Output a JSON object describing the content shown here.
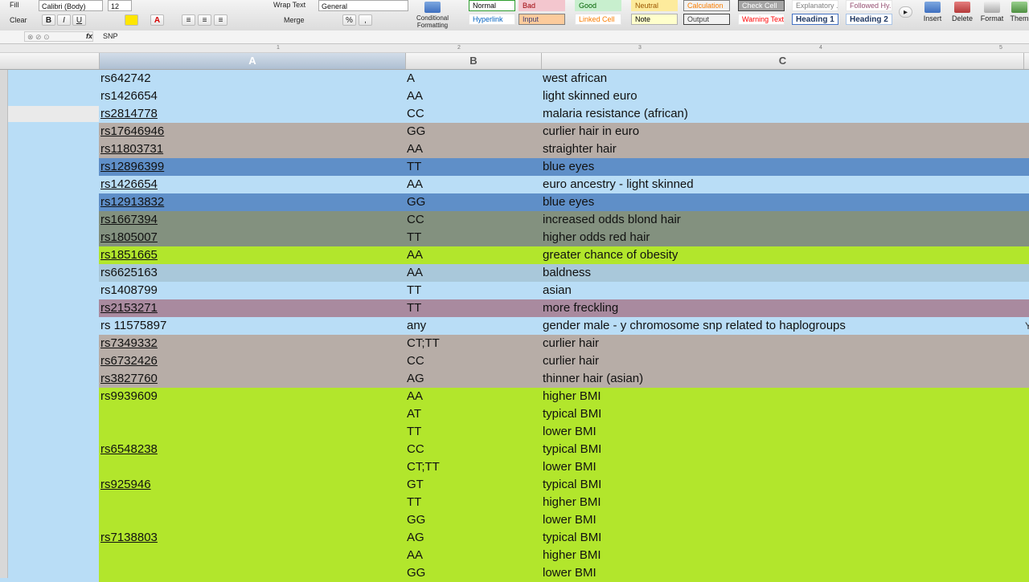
{
  "ribbon": {
    "fill_label": "Fill",
    "clear_label": "Clear",
    "font_name": "Calibri (Body)",
    "font_size": "12",
    "bold": "B",
    "italic": "I",
    "underline": "U",
    "wrap_text": "Wrap Text",
    "merge": "Merge",
    "number_format": "General",
    "percent": "%",
    "comma": ",",
    "conditional_formatting": "Conditional Formatting",
    "styles": [
      {
        "label": "Normal",
        "bg": "#ffffff",
        "fg": "#000000",
        "border": "#2e9e2e"
      },
      {
        "label": "Bad",
        "bg": "#f3c6ce",
        "fg": "#9c0006",
        "border": "#f3c6ce"
      },
      {
        "label": "Good",
        "bg": "#c8efce",
        "fg": "#006100",
        "border": "#c8efce"
      },
      {
        "label": "Neutral",
        "bg": "#fdeb9c",
        "fg": "#9c5700",
        "border": "#fdeb9c"
      },
      {
        "label": "Calculation",
        "bg": "#f2f2f2",
        "fg": "#fa7d00",
        "border": "#7f7f7f"
      },
      {
        "label": "Check Cell",
        "bg": "#a5a5a5",
        "fg": "#ffffff",
        "border": "#3f3f3f"
      },
      {
        "label": "Explanatory ...",
        "bg": "#ffffff",
        "fg": "#7f7f7f",
        "border": "#e6e6e6"
      },
      {
        "label": "Followed Hy...",
        "bg": "#ffffff",
        "fg": "#954f72",
        "border": "#e6e6e6"
      },
      {
        "label": "Hyperlink",
        "bg": "#ffffff",
        "fg": "#0563c1",
        "border": "#e6e6e6"
      },
      {
        "label": "Input",
        "bg": "#fccb9c",
        "fg": "#3f3f76",
        "border": "#7f7f7f"
      },
      {
        "label": "Linked Cell",
        "bg": "#ffffff",
        "fg": "#fa7d00",
        "border": "#e6e6e6"
      },
      {
        "label": "Note",
        "bg": "#ffffcc",
        "fg": "#000000",
        "border": "#b2b2b2"
      },
      {
        "label": "Output",
        "bg": "#f2f2f2",
        "fg": "#3f3f3f",
        "border": "#3f3f3f"
      },
      {
        "label": "Warning Text",
        "bg": "#ffffff",
        "fg": "#ff0000",
        "border": "#e6e6e6"
      },
      {
        "label": "Heading 1",
        "bg": "#ffffff",
        "fg": "#1f3864",
        "border": "#4472c4"
      },
      {
        "label": "Heading 2",
        "bg": "#ffffff",
        "fg": "#1f3864",
        "border": "#a9c4e7"
      }
    ],
    "insert": "Insert",
    "delete": "Delete",
    "format": "Format",
    "themes": "Them"
  },
  "formula_bar": {
    "fx": "fx",
    "content": "SNP"
  },
  "columns": [
    "A",
    "B",
    "C"
  ],
  "rows": [
    {
      "a": "rs642742",
      "b": "A",
      "c": "west african",
      "d": "",
      "link": false,
      "bg": "#b9ddf6"
    },
    {
      "a": "rs1426654",
      "b": "AA",
      "c": "light skinned euro",
      "d": "",
      "link": false,
      "bg": "#b9ddf6"
    },
    {
      "a": "rs2814778",
      "b": "CC",
      "c": "malaria resistance (african)",
      "d": "",
      "link": true,
      "bg": "#b9ddf6"
    },
    {
      "a": "rs17646946",
      "b": "GG",
      "c": "curlier hair in euro",
      "d": "",
      "link": true,
      "bg": "#b7ada7"
    },
    {
      "a": "rs11803731",
      "b": "AA",
      "c": "straighter hair",
      "d": "",
      "link": true,
      "bg": "#b7ada7"
    },
    {
      "a": "rs12896399",
      "b": "TT",
      "c": "blue eyes",
      "d": "",
      "link": true,
      "bg": "#5f8fc8"
    },
    {
      "a": "rs1426654",
      "b": "AA",
      "c": "euro ancestry - light skinned",
      "d": "",
      "link": true,
      "bg": "#b9ddf6"
    },
    {
      "a": "rs12913832",
      "b": "GG",
      "c": "blue eyes",
      "d": "",
      "link": true,
      "bg": "#5f8fc8"
    },
    {
      "a": "rs1667394",
      "b": "CC",
      "c": "increased odds blond hair",
      "d": "",
      "link": true,
      "bg": "#83917f"
    },
    {
      "a": "rs1805007",
      "b": "TT",
      "c": "higher odds red hair",
      "d": "",
      "link": true,
      "bg": "#83917f"
    },
    {
      "a": "rs1851665",
      "b": "AA",
      "c": "greater chance of obesity",
      "d": "",
      "link": true,
      "bg": "#b2e62c"
    },
    {
      "a": "rs6625163",
      "b": "AA",
      "c": "baldness",
      "d": "",
      "link": false,
      "bg": "#a9c8da"
    },
    {
      "a": "rs1408799",
      "b": "TT",
      "c": "asian",
      "d": "",
      "link": false,
      "bg": "#b9ddf6"
    },
    {
      "a": "rs2153271",
      "b": "TT",
      "c": "more freckling",
      "d": "",
      "link": true,
      "bg": "#a98a9f"
    },
    {
      "a": "rs 11575897",
      "b": "any",
      "c": "gender male - y chromosome snp related to haplogroups",
      "d": "Y",
      "link": false,
      "bg": "#b9ddf6"
    },
    {
      "a": "rs7349332",
      "b": "CT;TT",
      "c": "curlier hair",
      "d": "",
      "link": true,
      "bg": "#b7ada7"
    },
    {
      "a": "rs6732426",
      "b": "CC",
      "c": "curlier hair",
      "d": "",
      "link": true,
      "bg": "#b7ada7"
    },
    {
      "a": "rs3827760",
      "b": "AG",
      "c": "thinner hair (asian)",
      "d": "",
      "link": true,
      "bg": "#b7ada7"
    },
    {
      "a": "rs9939609",
      "b": "AA",
      "c": "higher BMI",
      "d": "",
      "link": false,
      "bg": "#b2e62c"
    },
    {
      "a": "",
      "b": "AT",
      "c": "typical BMI",
      "d": "",
      "link": false,
      "bg": "#b2e62c"
    },
    {
      "a": "",
      "b": "TT",
      "c": "lower BMI",
      "d": "",
      "link": false,
      "bg": "#b2e62c"
    },
    {
      "a": "rs6548238",
      "b": "CC",
      "c": "typical BMI",
      "d": "",
      "link": true,
      "bg": "#b2e62c"
    },
    {
      "a": "",
      "b": "CT;TT",
      "c": "lower BMI",
      "d": "",
      "link": false,
      "bg": "#b2e62c"
    },
    {
      "a": "rs925946",
      "b": "GT",
      "c": "typical BMI",
      "d": "",
      "link": true,
      "bg": "#b2e62c"
    },
    {
      "a": "",
      "b": "TT",
      "c": "higher BMI",
      "d": "",
      "link": false,
      "bg": "#b2e62c"
    },
    {
      "a": "",
      "b": "GG",
      "c": "lower BMI",
      "d": "",
      "link": false,
      "bg": "#b2e62c"
    },
    {
      "a": "rs7138803",
      "b": "AG",
      "c": "typical BMI",
      "d": "",
      "link": true,
      "bg": "#b2e62c"
    },
    {
      "a": "",
      "b": "AA",
      "c": "higher BMI",
      "d": "",
      "link": false,
      "bg": "#b2e62c"
    },
    {
      "a": "",
      "b": "GG",
      "c": "lower BMI",
      "d": "",
      "link": false,
      "bg": "#b2e62c"
    }
  ]
}
